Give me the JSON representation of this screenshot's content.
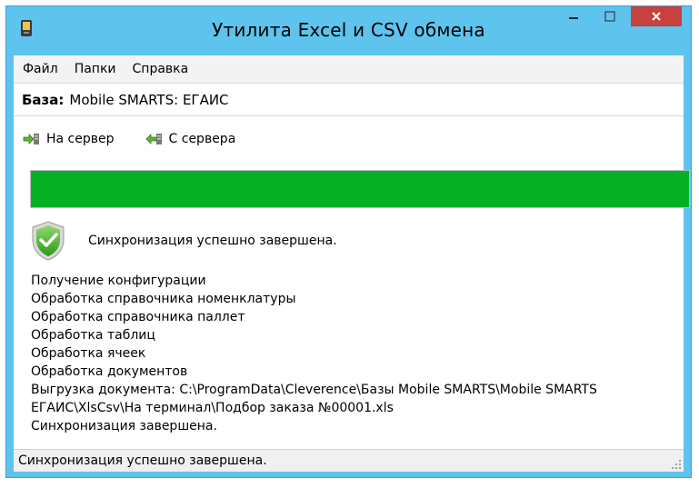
{
  "window": {
    "title": "Утилита Excel и CSV обмена"
  },
  "menu": {
    "items": [
      "Файл",
      "Папки",
      "Справка"
    ]
  },
  "database": {
    "label": "База:",
    "value": "Mobile SMARTS: ЕГАИС"
  },
  "toolbar": {
    "to_server_label": "На сервер",
    "from_server_label": "С сервера"
  },
  "progress": {
    "fraction": 1.0,
    "color": "#06b025"
  },
  "status": {
    "message": "Синхронизация успешно завершена."
  },
  "log": {
    "lines": [
      "Получение конфигурации",
      "Обработка справочника номенклатуры",
      "Обработка справочника паллет",
      "Обработка таблиц",
      "Обработка ячеек",
      "Обработка документов",
      "Выгрузка документа: C:\\ProgramData\\Cleverence\\Базы Mobile SMARTS\\Mobile SMARTS ЕГАИС\\XlsCsv\\На терминал\\Подбор заказа №00001.xls",
      "Синхронизация завершена."
    ]
  },
  "statusbar": {
    "text": "Синхронизация успешно завершена."
  },
  "icons": {
    "app": "mobile-device-icon",
    "success": "shield-check-icon",
    "to_server": "upload-arrow-icon",
    "from_server": "download-arrow-icon",
    "minimize": "minimize-icon",
    "maximize": "maximize-icon",
    "close": "close-icon"
  },
  "colors": {
    "titlebar": "#5ec4ee",
    "close_button": "#c7413d",
    "progress_fill": "#06b025"
  }
}
